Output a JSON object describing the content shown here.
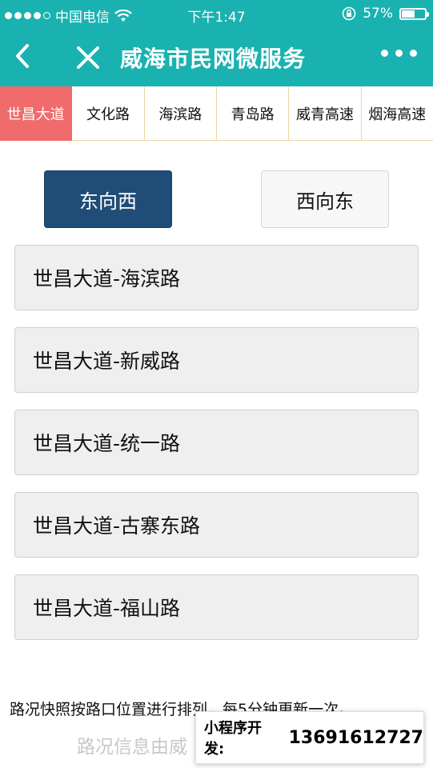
{
  "status_bar": {
    "carrier": "中国电信",
    "time": "下午1:47",
    "battery": "57%",
    "battery_level": 0.57
  },
  "nav": {
    "back_icon": "chevron-left-icon",
    "close_icon": "close-icon",
    "title": "威海市民网微服务",
    "more_icon": "more-dots-icon"
  },
  "tabs": [
    {
      "label": "世昌大道",
      "active": true
    },
    {
      "label": "文化路",
      "active": false
    },
    {
      "label": "海滨路",
      "active": false
    },
    {
      "label": "青岛路",
      "active": false
    },
    {
      "label": "威青高速",
      "active": false
    },
    {
      "label": "烟海高速",
      "active": false
    }
  ],
  "directions": {
    "east_to_west": "东向西",
    "west_to_east": "西向东",
    "selected": "east_to_west"
  },
  "intersections": [
    "世昌大道-海滨路",
    "世昌大道-新威路",
    "世昌大道-统一路",
    "世昌大道-古寨东路",
    "世昌大道-福山路"
  ],
  "footer": {
    "note": "路况快照按路口位置进行排列，每5分钟更新一次。",
    "source": "路况信息由威"
  },
  "promo": {
    "label": "小程序开发:",
    "phone": "13691612727"
  },
  "colors": {
    "header": "#1ab2b0",
    "active_tab": "#f06b6b",
    "selected_direction": "#1f4d77"
  }
}
